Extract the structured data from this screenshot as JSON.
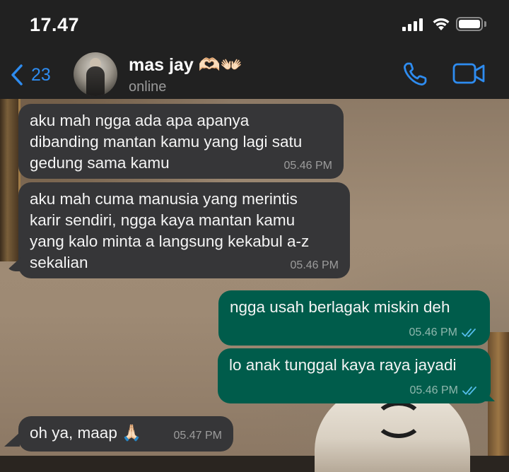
{
  "status_bar": {
    "time": "17.47"
  },
  "header": {
    "back_count": "23",
    "contact_name": "mas jay 🫶🏻👐🏻",
    "contact_status": "online"
  },
  "messages": [
    {
      "direction": "incoming",
      "text": "aku mah ngga ada apa apanya\ndibanding mantan kamu yang lagi satu\ngedung sama kamu",
      "time": "05.46 PM"
    },
    {
      "direction": "incoming",
      "text": "aku mah cuma manusia yang merintis\nkarir sendiri, ngga kaya mantan kamu\nyang kalo minta a langsung kekabul a-z\nsekalian",
      "time": "05.46 PM"
    },
    {
      "direction": "outgoing",
      "text": "ngga usah berlagak miskin deh",
      "time": "05.46 PM",
      "status": "read"
    },
    {
      "direction": "outgoing",
      "text": "lo anak tunggal kaya raya jayadi",
      "time": "05.46 PM",
      "status": "read"
    },
    {
      "direction": "incoming",
      "text": "oh ya, maap 🙏🏻",
      "time": "05.47 PM"
    }
  ],
  "colors": {
    "accent": "#2e8cf0",
    "incoming_bubble": "#363638",
    "outgoing_bubble": "#005c4b",
    "read_ticks": "#53bdeb"
  },
  "icons": [
    "signal-icon",
    "wifi-icon",
    "battery-icon",
    "chevron-left-icon",
    "phone-icon",
    "video-camera-icon",
    "double-check-icon"
  ]
}
